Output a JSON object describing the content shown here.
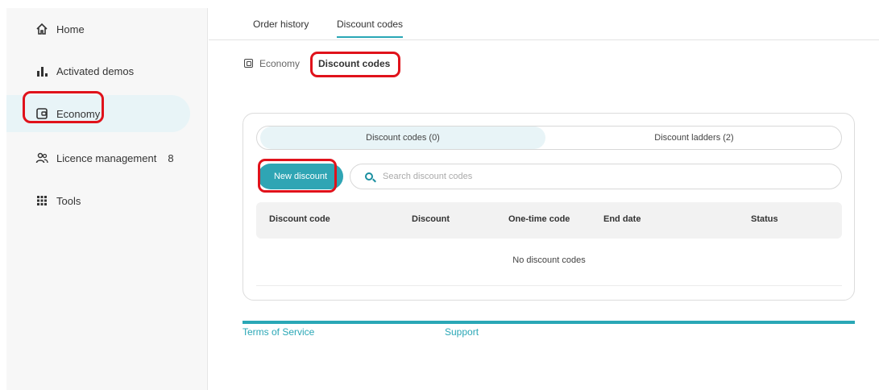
{
  "sidebar": {
    "items": [
      {
        "label": "Home",
        "icon": "home-icon"
      },
      {
        "label": "Activated demos",
        "icon": "bar-chart-icon"
      },
      {
        "label": "Economy",
        "icon": "wallet-icon",
        "active": true
      },
      {
        "label": "Licence management",
        "icon": "users-icon",
        "count": "8"
      },
      {
        "label": "Tools",
        "icon": "grid-icon"
      }
    ]
  },
  "top_tabs": [
    {
      "label": "Order history"
    },
    {
      "label": "Discount codes",
      "active": true
    }
  ],
  "breadcrumb": {
    "parent": "Economy",
    "current": "Discount codes"
  },
  "card": {
    "segments": [
      {
        "label": "Discount codes (0)",
        "active": true
      },
      {
        "label": "Discount ladders (2)"
      }
    ],
    "new_button": "New discount",
    "search": {
      "placeholder": "Search discount codes"
    },
    "columns": [
      "Discount code",
      "Discount",
      "One-time code",
      "End date",
      "Status"
    ],
    "empty_message": "No discount codes"
  },
  "footer": {
    "links": [
      "Terms of Service",
      "Support"
    ]
  },
  "colors": {
    "accent": "#2aa7b6",
    "highlight": "#e0121b",
    "active_bg": "#e8f4f7"
  }
}
